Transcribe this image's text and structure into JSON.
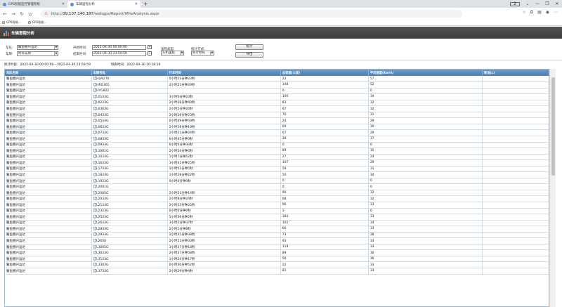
{
  "browser": {
    "tabs": [
      {
        "title": "GPS智能监控管理系统",
        "active": false
      },
      {
        "title": "车辆里程分析",
        "active": true
      }
    ],
    "url_host": "39.107.140.187",
    "url_path": "/webgps/Report/MileAnalysis.aspx",
    "bookmarks": [
      "GPS智能...",
      "GPS智能..."
    ]
  },
  "page": {
    "title": "车辆里程分析"
  },
  "filters": {
    "team_label": "车队:",
    "team_value": "鲅鱼圈兴运达",
    "vehicle_label": "车牌:",
    "vehicle_value": "所有车牌",
    "start_label": "开始时间:",
    "start_value": "2022-04-30 00:00:00",
    "end_label": "结束时间:",
    "end_value": "2022-04-30 23:59:59",
    "mileage_type_label": "里程类型:",
    "mileage_type_value": "车机里程",
    "stat_method_label": "统计方式:",
    "stat_method_value": "统计所有",
    "stat_button": "统计",
    "export_button": "导出"
  },
  "status": {
    "stat_time_label": "统计时段:",
    "stat_time_value": "2022-04-30 00:00:00---2022-04-30 23:59:59",
    "report_time_label": "制表时间:",
    "report_time_value": "2022-04-30 16:18:19"
  },
  "table": {
    "columns": [
      "车队名称",
      "车牌号码",
      "行车时间",
      "总里程(公里)",
      "平均速度(Km/h)",
      "耗油(L)"
    ],
    "rows": [
      [
        "鲅鱼圈兴运达",
        "辽HLW276",
        "0小时23分钟23秒",
        "22",
        "57",
        ""
      ],
      [
        "鲅鱼圈兴运达",
        "辽HRQ365",
        "2小时52分钟29秒",
        "148",
        "52",
        ""
      ],
      [
        "鲅鱼圈兴运达",
        "辽HYG822",
        "",
        "0",
        "0",
        ""
      ],
      [
        "鲅鱼圈兴运达",
        "辽L0133G",
        "3小时6分钟23秒",
        "106",
        "34",
        ""
      ],
      [
        "鲅鱼圈兴运达",
        "辽L0233G",
        "2小时38分钟49秒",
        "83",
        "32",
        ""
      ],
      [
        "鲅鱼圈兴运达",
        "辽L0303G",
        "2小时5分钟20秒",
        "67",
        "32",
        ""
      ],
      [
        "鲅鱼圈兴运达",
        "辽L0433G",
        "2小时28分钟23秒",
        "76",
        "31",
        ""
      ],
      [
        "鲅鱼圈兴运达",
        "辽L0533G",
        "0小时49分钟59秒",
        "24",
        "29",
        ""
      ],
      [
        "鲅鱼圈兴运达",
        "辽L0633G",
        "2小时18分钟19秒",
        "69",
        "30",
        ""
      ],
      [
        "鲅鱼圈兴运达",
        "辽L0733G",
        "2小时21分钟24秒",
        "67",
        "29",
        ""
      ],
      [
        "鲅鱼圈兴运达",
        "辽L0833G",
        "0小时45分钟3秒",
        "28",
        "37",
        ""
      ],
      [
        "鲅鱼圈兴运达",
        "辽L0933G",
        "0小时0分钟30秒",
        "0",
        "0",
        ""
      ],
      [
        "鲅鱼圈兴运达",
        "辽L1001G",
        "2小时34分钟0秒",
        "89",
        "35",
        ""
      ],
      [
        "鲅鱼圈兴运达",
        "辽L1033G",
        "1小时7分钟52秒",
        "27",
        "24",
        ""
      ],
      [
        "鲅鱼圈兴运达",
        "辽L1633G",
        "3小时41分钟25秒",
        "107",
        "29",
        ""
      ],
      [
        "鲅鱼圈兴运达",
        "辽L1733G",
        "1小时53分钟5秒",
        "59",
        "31",
        ""
      ],
      [
        "鲅鱼圈兴运达",
        "辽L1833G",
        "1小时28分钟22秒",
        "50",
        "34",
        ""
      ],
      [
        "鲅鱼圈兴运达",
        "辽L1933G",
        "0小时0分钟0秒",
        "0",
        "0",
        ""
      ],
      [
        "鲅鱼圈兴运达",
        "辽L2001G",
        "",
        "0",
        "0",
        ""
      ],
      [
        "鲅鱼圈兴运达",
        "辽L2005G",
        "2小时51分钟14秒",
        "90",
        "32",
        ""
      ],
      [
        "鲅鱼圈兴运达",
        "辽L2033G",
        "2小时8分钟24秒",
        "68",
        "32",
        ""
      ],
      [
        "鲅鱼圈兴运达",
        "辽L2133G",
        "2小时53分钟25秒",
        "96",
        "33",
        ""
      ],
      [
        "鲅鱼圈兴运达",
        "辽L2323G",
        "0小时0分钟0秒",
        "3",
        "0",
        ""
      ],
      [
        "鲅鱼圈兴运达",
        "辽L2533G",
        "5小时36分钟2秒",
        "184",
        "33",
        ""
      ],
      [
        "鲅鱼圈兴运达",
        "辽L2633G",
        "3小时2分钟37秒",
        "102",
        "34",
        ""
      ],
      [
        "鲅鱼圈兴运达",
        "辽L2833G",
        "2小时1分钟8秒",
        "66",
        "33",
        ""
      ],
      [
        "鲅鱼圈兴运达",
        "辽L2933G",
        "2小时35分钟38秒",
        "73",
        "28",
        ""
      ],
      [
        "鲅鱼圈兴运达",
        "辽L2658",
        "2小时51分钟33秒",
        "93",
        "33",
        ""
      ],
      [
        "鲅鱼圈兴运达",
        "辽L3005G",
        "3小时37分钟18秒",
        "118",
        "33",
        ""
      ],
      [
        "鲅鱼圈兴运达",
        "辽L3033G",
        "2小时37分钟58秒",
        "89",
        "30",
        ""
      ],
      [
        "鲅鱼圈兴运达",
        "辽L3133G",
        "1小时24分钟17秒",
        "50",
        "36",
        ""
      ],
      [
        "鲅鱼圈兴运达",
        "辽L3303G",
        "0小时40分钟52秒",
        "22",
        "33",
        ""
      ],
      [
        "鲅鱼圈兴运达",
        "辽L3733G",
        "2小时29分钟4秒",
        "81",
        "33",
        ""
      ]
    ]
  }
}
